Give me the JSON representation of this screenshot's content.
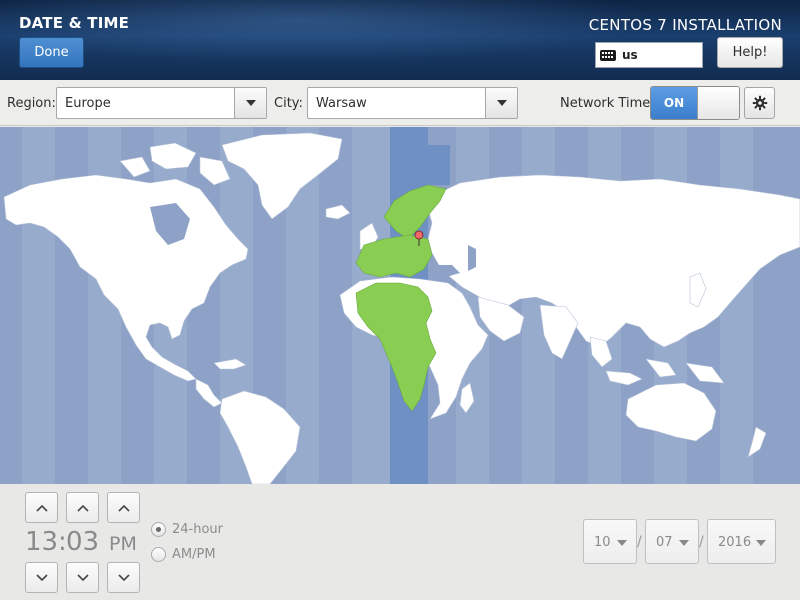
{
  "header": {
    "page_title": "DATE & TIME",
    "done_label": "Done",
    "product_title": "CENTOS 7 INSTALLATION",
    "keyboard_layout": "us",
    "help_label": "Help!"
  },
  "toolbar": {
    "region_label": "Region:",
    "region_value": "Europe",
    "city_label": "City:",
    "city_value": "Warsaw",
    "network_time_label": "Network Time",
    "network_time_state": "ON"
  },
  "map": {
    "selected_zone_color": "#8acd53",
    "ocean_color": "#8da2c6",
    "land_color": "#ffffff",
    "highlight_band_color": "#6f90c4",
    "pin_city": "Warsaw"
  },
  "time": {
    "hours": "13",
    "separator": ":",
    "minutes": "03",
    "period": "PM",
    "format_24_label": "24-hour",
    "format_ampm_label": "AM/PM",
    "selected_format": "24-hour"
  },
  "date": {
    "month": "10",
    "day": "07",
    "year": "2016",
    "separator": "/"
  },
  "colors": {
    "accent": "#3a7dca",
    "header_bg": "#112b4f"
  }
}
